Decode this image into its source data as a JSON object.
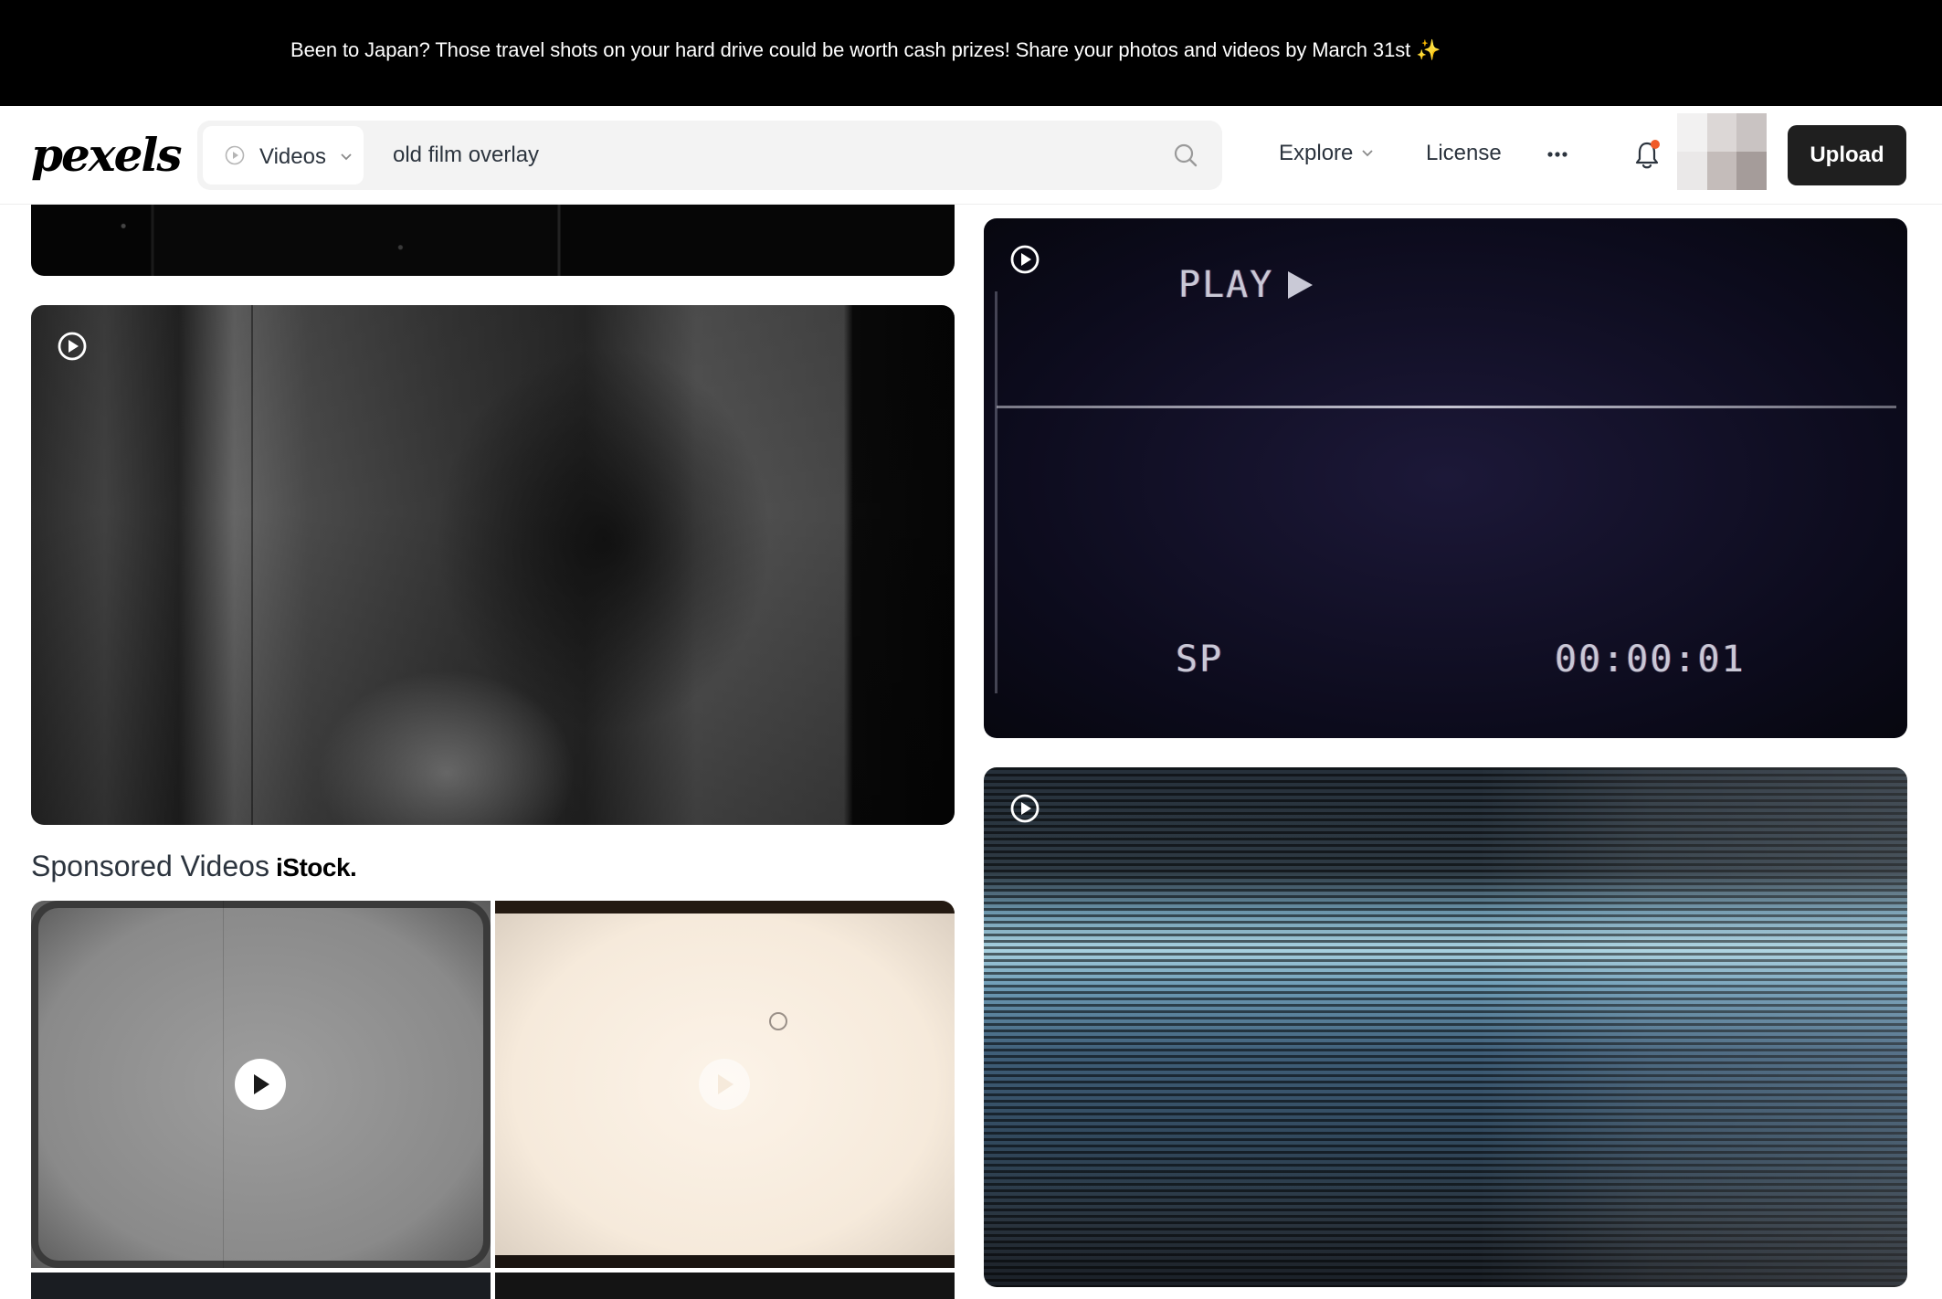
{
  "banner": {
    "text": "Been to Japan? Those travel shots on your hard drive could be worth cash prizes! Share your photos and videos by March 31st",
    "sparkle": "✨"
  },
  "nav": {
    "logo": "pexels",
    "media_type": "Videos",
    "search_value": "old film overlay",
    "explore": "Explore",
    "license": "License",
    "upload": "Upload"
  },
  "results": {
    "vhs_tile": {
      "play_text": "PLAY",
      "mode_text": "SP",
      "timecode": "00:00:01"
    }
  },
  "sponsored": {
    "title": "Sponsored Videos",
    "brand": "iStock."
  },
  "colors": {
    "notification_dot": "#f05a28",
    "upload_bg": "#1f1f1f"
  }
}
